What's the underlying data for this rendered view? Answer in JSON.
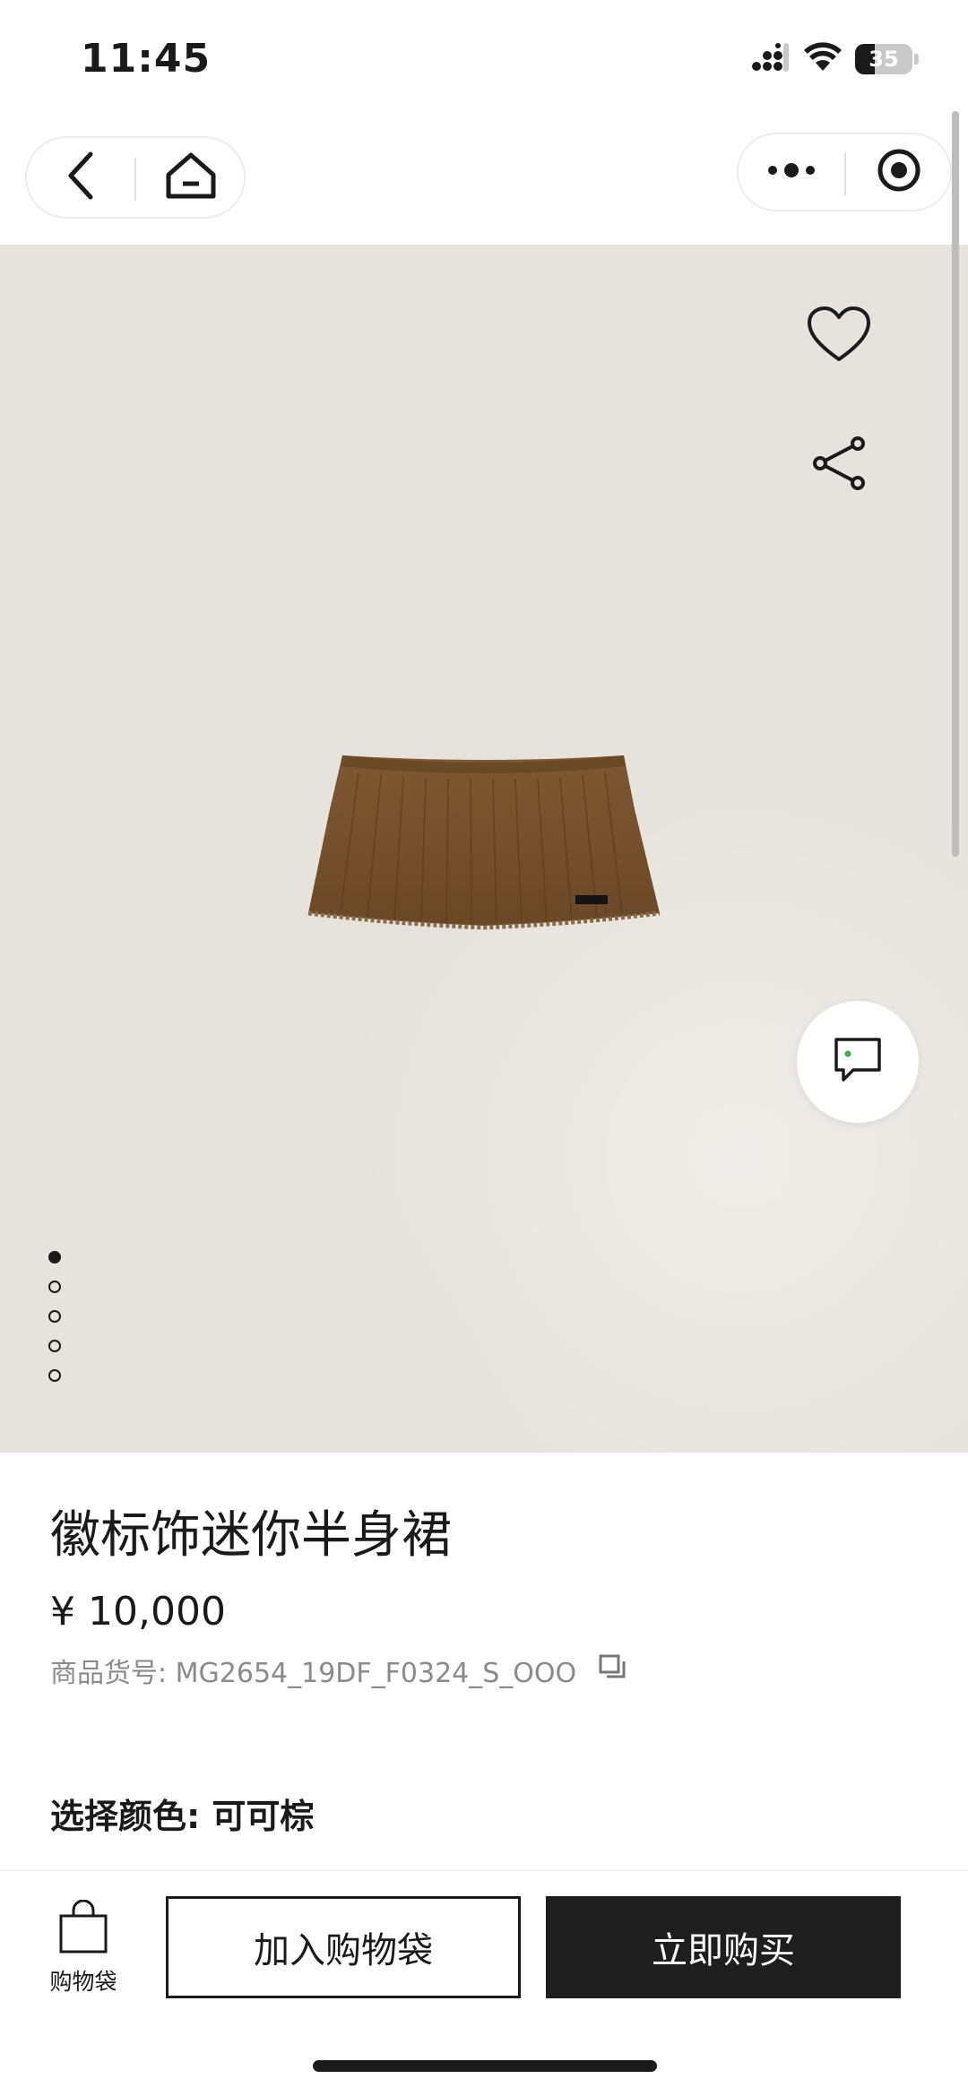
{
  "status_bar": {
    "time": "11:45",
    "battery_level": "35",
    "icons": [
      "signal-icon",
      "wifi-icon",
      "battery-icon"
    ]
  },
  "nav": {
    "left_capsule_icons": [
      "back-arrow-icon",
      "home-icon"
    ],
    "right_capsule_icons": [
      "more-dots-icon",
      "target-close-icon"
    ]
  },
  "gallery": {
    "image_icon": "product-skirt-image",
    "total_images": 5,
    "active_index": 0,
    "actions": [
      "heart-icon",
      "share-icon"
    ],
    "chat_icon": "chat-bubble-icon"
  },
  "product": {
    "title": "徽标饰迷你半身裙",
    "price": "¥ 10,000",
    "sku_label": "商品货号: MG2654_19DF_F0324_S_OOO",
    "color_label": "选择颜色: 可可棕"
  },
  "bottom_bar": {
    "bag_label": "购物袋",
    "add_to_bag": "加入购物袋",
    "buy_now": "立即购买"
  },
  "colors": {
    "hero_background": "#e6e3dc",
    "skirt_brown": "#7a5530",
    "primary_button": "#1e1e1e",
    "chat_dot": "#3cb043"
  }
}
